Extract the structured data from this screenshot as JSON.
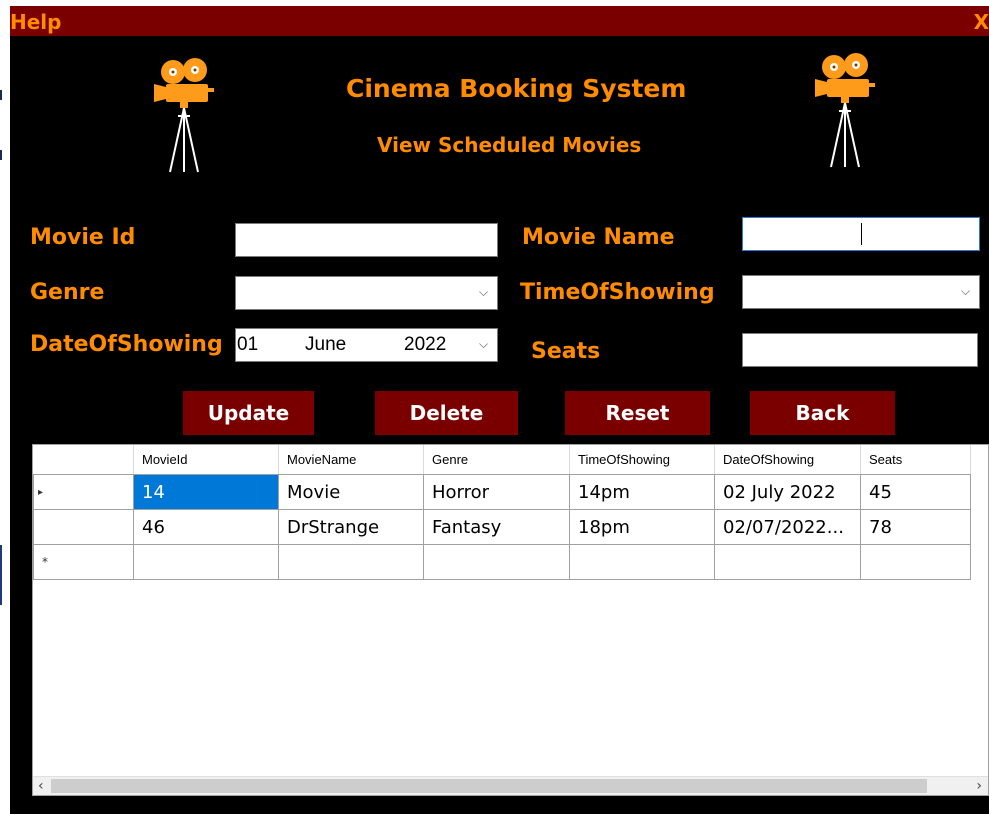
{
  "window": {
    "title": "Help",
    "close_label": "X"
  },
  "header": {
    "title": "Cinema Booking System",
    "subtitle": "View Scheduled Movies"
  },
  "form": {
    "movie_id": {
      "label": "Movie Id",
      "value": ""
    },
    "movie_name": {
      "label": "Movie Name",
      "value": ""
    },
    "genre": {
      "label": "Genre",
      "value": ""
    },
    "time_of_showing": {
      "label": "TimeOfShowing",
      "value": ""
    },
    "date_of_showing": {
      "label": "DateOfShowing",
      "day": "01",
      "month": "June",
      "year": "2022"
    },
    "seats": {
      "label": "Seats",
      "value": ""
    }
  },
  "buttons": {
    "update": "Update",
    "delete": "Delete",
    "reset": "Reset",
    "back": "Back"
  },
  "grid": {
    "columns": [
      "MovieId",
      "MovieName",
      "Genre",
      "TimeOfShowing",
      "DateOfShowing",
      "Seats"
    ],
    "rows": [
      {
        "indicator": "▸",
        "cells": [
          "14",
          "Movie",
          "Horror",
          "14pm",
          "02 July 2022",
          "45"
        ]
      },
      {
        "indicator": "",
        "cells": [
          "46",
          "DrStrange",
          "Fantasy",
          "18pm",
          "02/07/2022...",
          "78"
        ]
      }
    ],
    "new_row_indicator": "*"
  },
  "icons": {
    "camera_left": "film-camera-icon",
    "camera_right": "film-camera-icon",
    "dropdown": "chevron-down-icon",
    "scroll_left": "scroll-left-arrow-icon",
    "scroll_right": "scroll-right-arrow-icon"
  },
  "colors": {
    "accent": "#ff8c00",
    "title_bar": "#7a0000",
    "button": "#7a0000",
    "background": "#000000",
    "selection": "#0078d7"
  }
}
